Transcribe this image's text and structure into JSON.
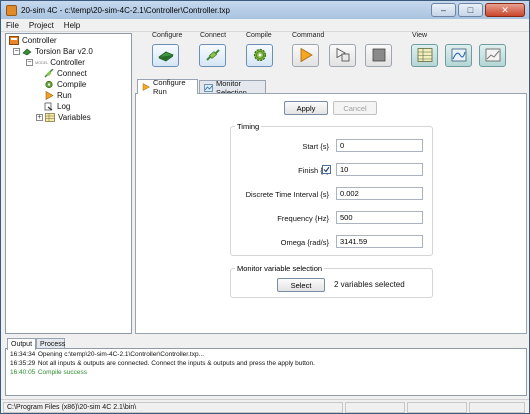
{
  "window": {
    "title": "20-sim 4C - c:\\temp\\20-sim-4C-2.1\\Controller\\Controller.txp"
  },
  "menu": [
    "File",
    "Project",
    "Help"
  ],
  "tree": {
    "root": "Controller",
    "target": "Torsion Bar v2.0",
    "target_tag": "FILE",
    "controller": "Controller",
    "controller_tag": "MODEL",
    "items": [
      "Connect",
      "Compile",
      "Run",
      "Log",
      "Variables"
    ]
  },
  "toolbar": {
    "configure": "Configure",
    "connect": "Connect",
    "compile": "Compile",
    "command": "Command",
    "view": "View"
  },
  "tabs": {
    "configure_run": "Configure Run",
    "monitor_selection": "Monitor Selection"
  },
  "buttons": {
    "apply": "Apply",
    "cancel": "Cancel",
    "select": "Select"
  },
  "timing": {
    "legend": "Timing",
    "start_label": "Start {s}",
    "start_value": "0",
    "finish_label": "Finish {s}",
    "finish_value": "10",
    "finish_checked": true,
    "interval_label": "Discrete Time Interval {s}",
    "interval_value": "0.002",
    "frequency_label": "Frequency {Hz}",
    "frequency_value": "500",
    "omega_label": "Omega {rad/s}",
    "omega_value": "3141.59"
  },
  "monitor": {
    "legend": "Monitor variable selection",
    "status": "2 variables selected"
  },
  "output": {
    "tabs": [
      "Output",
      "Process"
    ],
    "lines": [
      {
        "time": "16:34:34",
        "text": "Opening c:\\temp\\20-sim-4C-2.1\\Controller\\Controller.txp...",
        "color": "#000000"
      },
      {
        "time": "16:35:29",
        "text": "Not all inputs & outputs are connected. Connect the inputs & outputs and press the apply button.",
        "color": "#000000"
      },
      {
        "time": "16:40:05",
        "text": "Compile success",
        "color": "#2e8b2e"
      }
    ]
  },
  "status": {
    "path": "C:\\Program Files (x86)\\20-sim 4C 2.1\\bin\\"
  },
  "colors": {
    "accent": "#6d8fb6",
    "success": "#2e8b2e"
  }
}
